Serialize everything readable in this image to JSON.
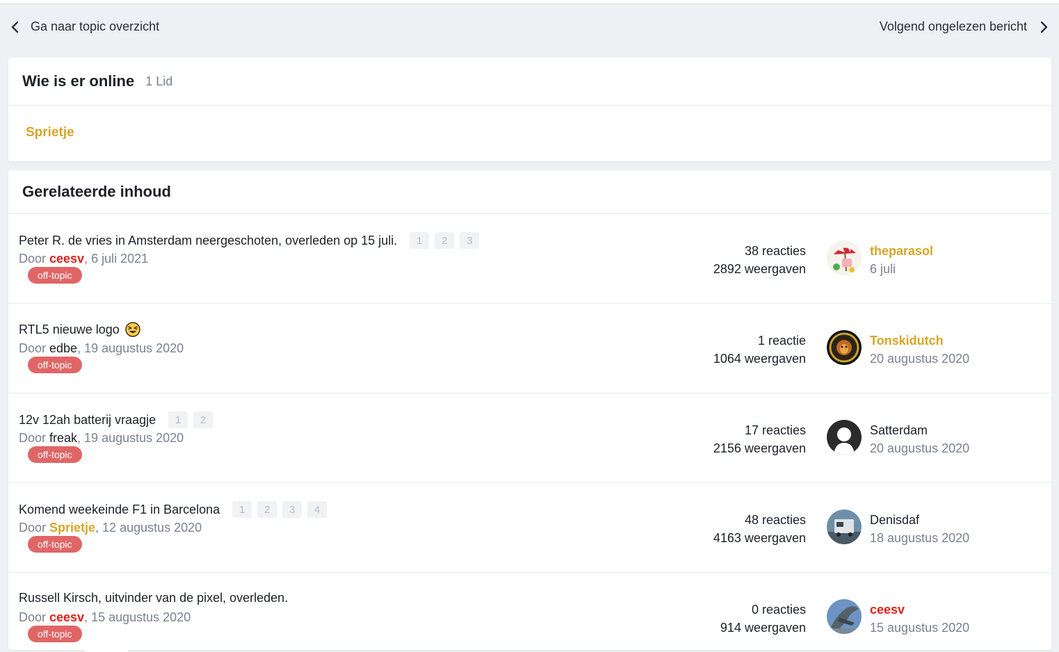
{
  "nav": {
    "back_label": "Ga naar topic overzicht",
    "next_label": "Volgend ongelezen bericht"
  },
  "online": {
    "title": "Wie is er online",
    "count": "1 Lid",
    "user": "Sprietje"
  },
  "related": {
    "title": "Gerelateerde inhoud",
    "by_prefix": "Door ",
    "rows": [
      {
        "title": "Peter R. de vries in Amsterdam neergeschoten, overleden op 15 juli.",
        "pages": [
          "1",
          "2",
          "3"
        ],
        "author": "ceesv",
        "date": ", 6 juli 2021",
        "tag": "off-topic",
        "replies": "38 reacties",
        "views": "2892 weergaven",
        "last_user": "theparasol",
        "last_date": "6 juli"
      },
      {
        "title": "RTL5 nieuwe logo",
        "pages": [],
        "author": "edbe",
        "date": ", 19 augustus 2020",
        "tag": "off-topic",
        "replies": "1 reactie",
        "views": "1064 weergaven",
        "last_user": "Tonskidutch",
        "last_date": "20 augustus 2020"
      },
      {
        "title": "12v 12ah batterij vraagje",
        "pages": [
          "1",
          "2"
        ],
        "author": "freak",
        "date": ", 19 augustus 2020",
        "tag": "off-topic",
        "replies": "17 reacties",
        "views": "2156 weergaven",
        "last_user": "Satterdam",
        "last_date": "20 augustus 2020"
      },
      {
        "title": "Komend weekeinde F1 in Barcelona",
        "pages": [
          "1",
          "2",
          "3",
          "4"
        ],
        "author": "Sprietje",
        "date": ", 12 augustus 2020",
        "tag": "off-topic",
        "replies": "48 reacties",
        "views": "4163 weergaven",
        "last_user": "Denisdaf",
        "last_date": "18 augustus 2020"
      },
      {
        "title": "Russell Kirsch, uitvinder van de pixel, overleden.",
        "pages": [],
        "author": "ceesv",
        "date": ", 15 augustus 2020",
        "tag": "off-topic",
        "replies": "0 reacties",
        "views": "914 weergaven",
        "last_user": "ceesv",
        "last_date": "15 augustus 2020"
      }
    ]
  },
  "colors": {
    "accent_gold": "#d6a628",
    "admin_red": "#e0201a",
    "tag_red": "#e06666",
    "muted": "#7a8290"
  },
  "icons": {
    "back": "chevron-left-icon",
    "next": "chevron-right-icon",
    "emoji": "grinning-squint-emoji-icon"
  }
}
